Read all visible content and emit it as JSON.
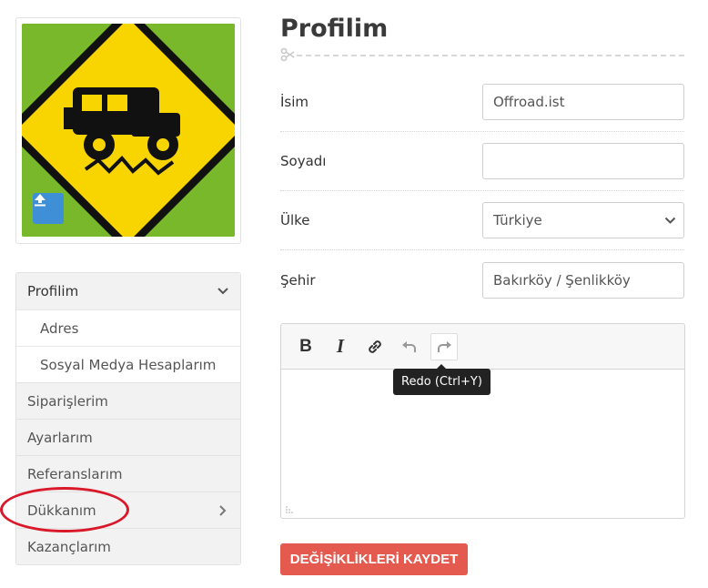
{
  "colors": {
    "accent_button": "#e55a4f",
    "upload_button": "#3f8fd6",
    "highlight_circle": "#d9192a",
    "avatar_bg": "#79b82b",
    "sign_yellow": "#f9d500"
  },
  "profile": {
    "upload_icon": "upload-icon"
  },
  "sidebar": {
    "items": [
      {
        "label": "Profilim",
        "chevron": "chevron-down-icon",
        "active": true
      },
      {
        "label": "Adres",
        "sub": true
      },
      {
        "label": "Sosyal Medya Hesaplarım",
        "sub": true
      },
      {
        "label": "Siparişlerim"
      },
      {
        "label": "Ayarlarım"
      },
      {
        "label": "Referanslarım"
      },
      {
        "label": "Dükkanım",
        "chevron": "chevron-right-icon"
      },
      {
        "label": "Kazançlarım"
      }
    ]
  },
  "main": {
    "title": "Profilim",
    "fields": {
      "name": {
        "label": "İsim",
        "value": "Offroad.ist"
      },
      "surname": {
        "label": "Soyadı",
        "value": ""
      },
      "country": {
        "label": "Ülke",
        "value": "Türkiye"
      },
      "city": {
        "label": "Şehir",
        "value": "Bakırköy / Şenlikköy"
      }
    },
    "editor": {
      "tooltip": "Redo (Ctrl+Y)",
      "bold_label": "B",
      "italic_label": "I"
    },
    "save_label": "DEĞİŞİKLİKLERİ KAYDET"
  }
}
